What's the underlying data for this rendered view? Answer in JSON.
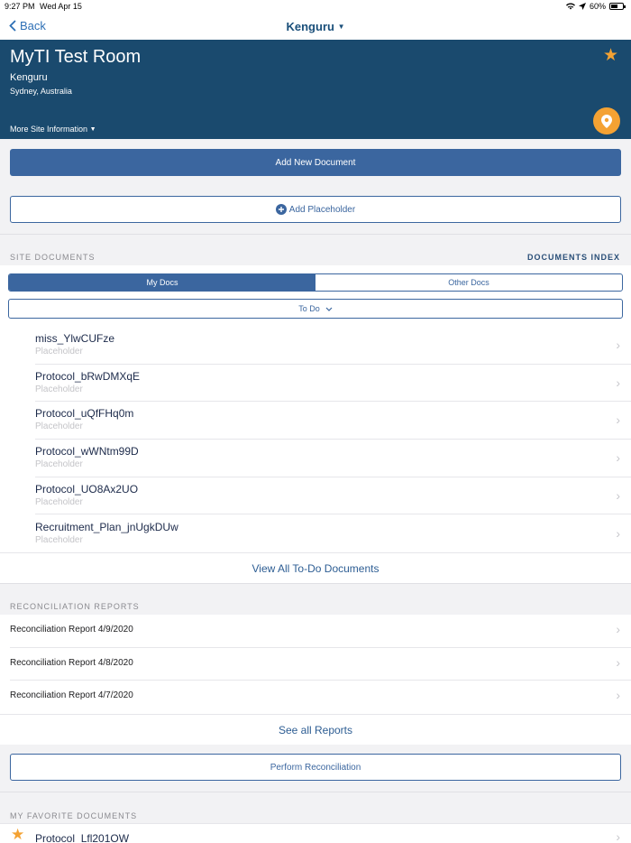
{
  "status_bar": {
    "time": "9:27 PM",
    "date": "Wed Apr 15",
    "battery": "60%",
    "battery_level": 0.6
  },
  "nav": {
    "back_label": "Back",
    "title": "Kenguru"
  },
  "header": {
    "title": "MyTI Test Room",
    "site_name": "Kenguru",
    "location": "Sydney, Australia",
    "more_info": "More Site Information"
  },
  "actions": {
    "add_document": "Add New Document",
    "add_placeholder": "Add Placeholder"
  },
  "site_documents": {
    "header": "SITE DOCUMENTS",
    "index_link": "DOCUMENTS INDEX",
    "tabs": [
      {
        "label": "My Docs"
      },
      {
        "label": "Other Docs"
      }
    ],
    "filter": "To Do",
    "items": [
      {
        "title": "miss_YlwCUFze",
        "type": "Placeholder"
      },
      {
        "title": "Protocol_bRwDMXqE",
        "type": "Placeholder"
      },
      {
        "title": "Protocol_uQfFHq0m",
        "type": "Placeholder"
      },
      {
        "title": "Protocol_wWNtm99D",
        "type": "Placeholder"
      },
      {
        "title": "Protocol_UO8Ax2UO",
        "type": "Placeholder"
      },
      {
        "title": "Recruitment_Plan_jnUgkDUw",
        "type": "Placeholder"
      }
    ],
    "view_all": "View All To-Do Documents"
  },
  "reconciliation": {
    "header": "RECONCILIATION REPORTS",
    "items": [
      {
        "title": "Reconciliation Report 4/9/2020"
      },
      {
        "title": "Reconciliation Report 4/8/2020"
      },
      {
        "title": "Reconciliation Report 4/7/2020"
      }
    ],
    "see_all": "See all Reports",
    "perform": "Perform Reconciliation"
  },
  "favorites": {
    "header": "MY FAVORITE DOCUMENTS",
    "items": [
      {
        "title": "Protocol_Lfl201OW"
      }
    ]
  },
  "colors": {
    "header_bg": "#1a4a6e",
    "accent": "#3b669f",
    "star": "#f4a233"
  }
}
